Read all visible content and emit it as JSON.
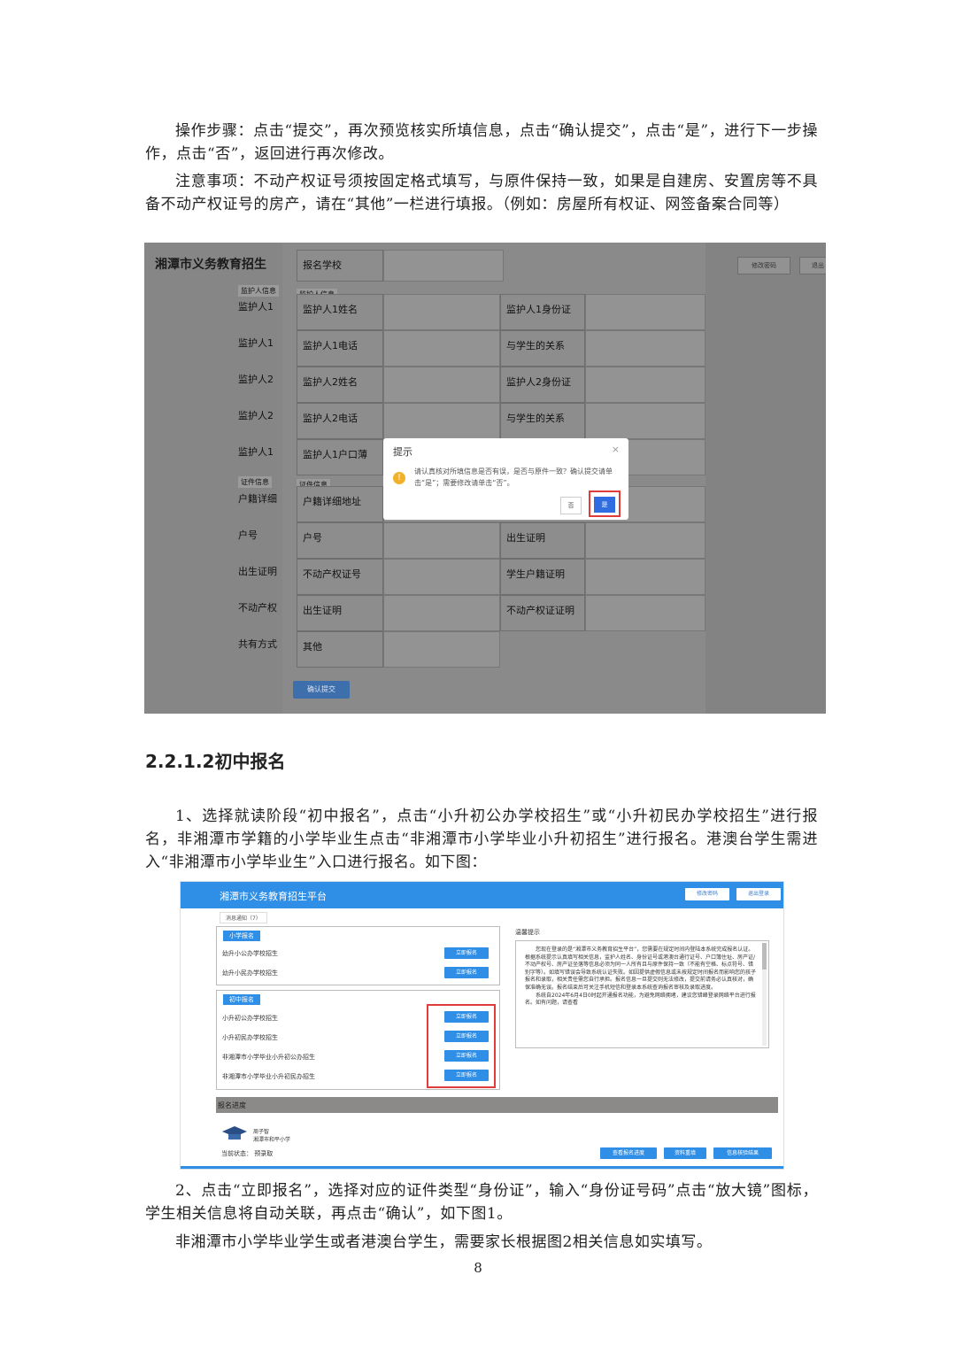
{
  "paragraphs": {
    "p1": "操作步骤：点击“提交”，再次预览核实所填信息，点击“确认提交”，点击“是”，进行下一步操作，点击“否”，返回进行再次修改。",
    "p2": "注意事项：不动产权证号须按固定格式填写，与原件保持一致，如果是自建房、安置房等不具备不动产权证号的房产，请在“其他”一栏进行填报。（例如：房屋所有权证、网签备案合同等）",
    "heading": "2.2.1.2初中报名",
    "p3": "1、选择就读阶段“初中报名”，点击“小升初公办学校招生”或“小升初民办学校招生”进行报名，非湘潭市学籍的小学毕业生点击“非湘潭市小学毕业小升初招生”进行报名。港澳台学生需进入“非湘潭市小学毕业生”入口进行报名。如下图：",
    "p4": "2、点击“立即报名”，选择对应的证件类型“身份证”，输入“身份证号码”点击“放大镜”图标，学生相关信息将自动关联，再点击“确认”，如下图1。",
    "p5": "非湘潭市小学毕业学生或者港澳台学生，需要家长根据图2相关信息如实填写。"
  },
  "page_number": "8",
  "shot1": {
    "title": "湘潭市义务教育招生",
    "school_label": "报名学校",
    "section_guardian": "监护人信息",
    "section_cert": "证件信息",
    "left_labels": [
      "监护人1",
      "监护人1",
      "监护人2",
      "监护人2",
      "监护人1",
      "户籍详细",
      "户号",
      "出生证明",
      "不动产权",
      "共有方式"
    ],
    "form_left": [
      "监护人1姓名",
      "监护人1电话",
      "监护人2姓名",
      "监护人2电话",
      "监护人1户口薄",
      "户籍详细地址",
      "户号",
      "不动产权证号",
      "出生证明",
      "其他"
    ],
    "form_right": [
      "监护人1身份证",
      "与学生的关系",
      "监护人2身份证",
      "与学生的关系",
      "",
      "",
      "出生证明",
      "学生户籍证明",
      "不动产权证证明",
      ""
    ],
    "top_buttons": [
      "修改密码",
      "退出"
    ],
    "submit_label": "确认提交",
    "dialog": {
      "title": "提示",
      "close": "×",
      "message": "请认真核对所填信息是否有误，是否与原件一致？确认提交请单击“是”；需要修改请单击“否”。",
      "no_label": "否",
      "yes_label": "是",
      "warn_symbol": "!"
    }
  },
  "shot2": {
    "title": "湘潭市义务教育招生平台",
    "top_buttons": [
      "修改密码",
      "退出登录"
    ],
    "notice": "消息通知（7）",
    "primary": {
      "tag": "小学报名",
      "rows": [
        "幼升小公办学校招生",
        "幼升小民办学校招生"
      ]
    },
    "middle": {
      "tag": "初中报名",
      "rows": [
        "小升初公办学校招生",
        "小升初民办学校招生",
        "非湘潭市小学毕业小升初公办招生",
        "非湘潭市小学毕业小升初民办招生"
      ]
    },
    "apply_label": "立即报名",
    "tips_title": "温馨提示",
    "tips_text": "您现在登录的是“湘潭市义务教育招生平台”，您需要在规定时间内登陆本系统完成报名认证。根据系统提示认真填写相关信息，监护人姓名、身份证号或港澳台通行证号、户口簿住址、房产证/不动产权号、房产证坐落等信息必须为同一人所有且与原件保持一致（不能有空格、标点符号、错别字等）。如填写错误会导致系统认证失败。如因提供虚假信息或未按规定时间报名而影响您的孩子报名和录取，相关责任需您自行承担。报名信息一旦提交则无法修改，提交前请务必认真核对，确保准确无误。报名结束后可关注手机短信和登录本系统查询报名审核及录取进度。",
    "tips_text2": "系统自2024年6月4日0时起开通报名功能，为避免网络拥堵，建议您错峰登录网络平台进行报名。如有问题，请查看",
    "progress_label": "报名进度",
    "student_name": "周子智",
    "student_school": "湘潭市和平小学",
    "status_label": "当前状态：",
    "status_value": "预录取",
    "bottom_buttons": [
      "查看报名进度",
      "资料重填",
      "信息核验结果"
    ]
  }
}
